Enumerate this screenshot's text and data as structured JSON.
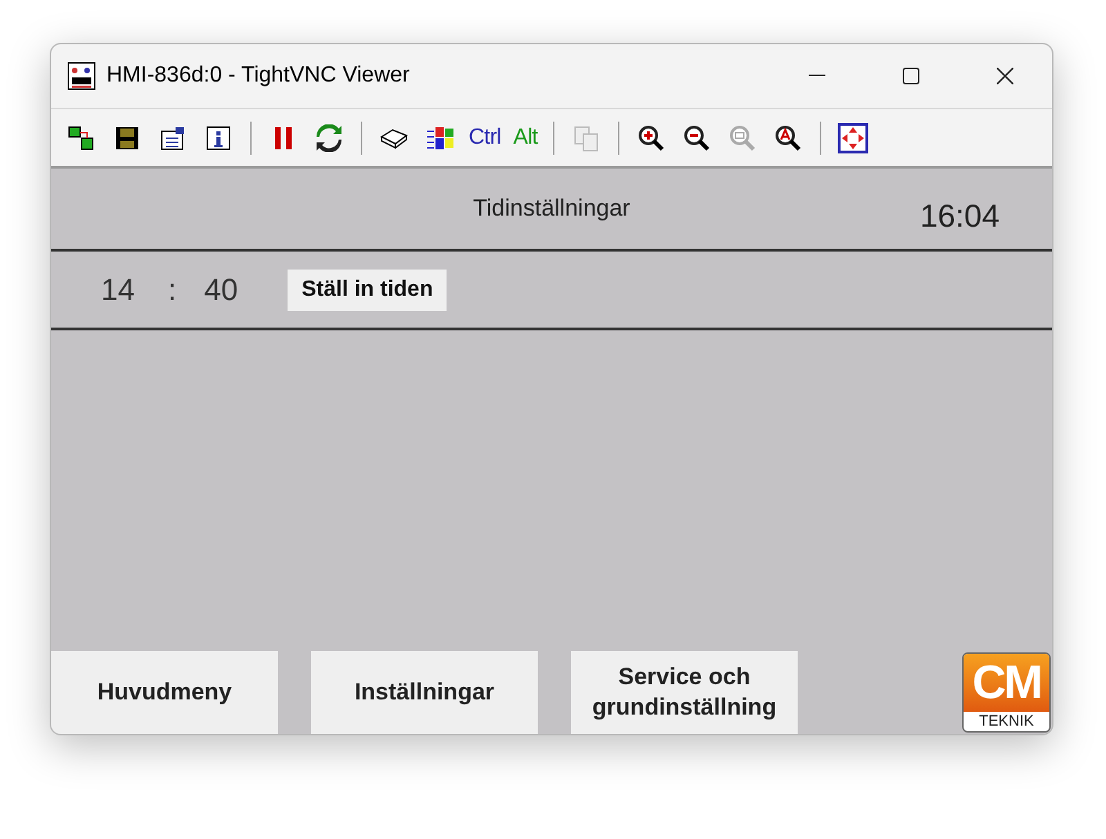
{
  "window": {
    "title": "HMI-836d:0 - TightVNC Viewer"
  },
  "toolbar": {
    "ctrl_label": "Ctrl",
    "alt_label": "Alt"
  },
  "screen": {
    "title": "Tidinställningar",
    "clock": "16:04",
    "time_setting": {
      "hours": "14",
      "separator": ":",
      "minutes": "40",
      "button": "Ställ in tiden"
    },
    "nav_buttons": [
      "Huvudmeny",
      "Inställningar",
      "Service och grundinställning"
    ],
    "logo": {
      "main": "CM",
      "sub": "TEKNIK"
    }
  }
}
